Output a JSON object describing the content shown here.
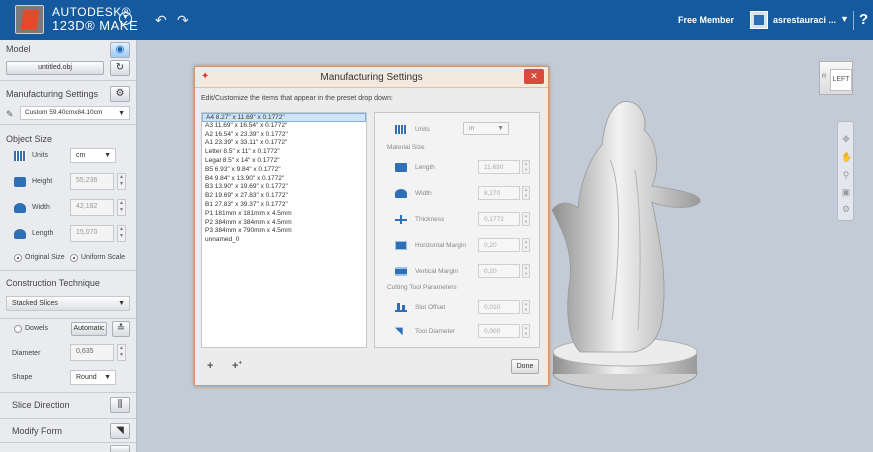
{
  "app": {
    "brand_line1": "AUTODESK®",
    "brand_line2": "123D® MAKE",
    "membership": "Free Member",
    "username": "asrestauraci ...",
    "help": "?"
  },
  "left_panel": {
    "model": {
      "title": "Model",
      "file": "untitled.obj"
    },
    "manufacturing": {
      "title": "Manufacturing Settings",
      "preset": "Custom 59.40cmx84.10cm"
    },
    "object_size": {
      "title": "Object Size",
      "units_label": "Units",
      "units_value": "cm",
      "height_label": "Height",
      "height_value": "55,236",
      "width_label": "Width",
      "width_value": "42,182",
      "length_label": "Length",
      "length_value": "15,070",
      "original_size": "Original Size",
      "uniform_scale": "Uniform Scale"
    },
    "construction": {
      "title": "Construction Technique",
      "value": "Stacked Slices"
    },
    "dowels": {
      "label": "Dowels",
      "mode": "Automatic",
      "diameter_label": "Diameter",
      "diameter_value": "0,635",
      "shape_label": "Shape",
      "shape_value": "Round"
    },
    "slice_direction": "Slice Direction",
    "modify_form": "Modify Form"
  },
  "dialog": {
    "title": "Manufacturing Settings",
    "description": "Edit/Customize the items that appear in the preset drop down:",
    "presets": [
      "A4 8.27\" x 11.69\" x 0.1772\"",
      "A3 11.69\" x 16.54\" x 0.1772\"",
      "A2 16.54\" x 23.39\" x 0.1772\"",
      "A1 23.39\" x 33.11\" x 0.1772\"",
      "Letter 8.5\" x 11\" x 0.1772\"",
      "Legal 8.5\" x 14\" x 0.1772\"",
      "B5 6.93\" x 9.84\" x 0.1772\"",
      "B4 9.84\" x 13.90\" x 0.1772\"",
      "B3 13.90\" x 19.69\" x 0.1772\"",
      "B2 19.69\" x 27.83\" x 0.1772\"",
      "B1 27.83\" x 39.37\" x 0.1772\"",
      "P1 181mm x 181mm x 4.5mm",
      "P2 384mm x 384mm x 4.5mm",
      "P3 384mm x 790mm x 4.5mm",
      "unnamed_0"
    ],
    "units_label": "Units",
    "units_value": "in",
    "material_size_header": "Material Size",
    "length_label": "Length",
    "length_value": "11,690",
    "width_label": "Width",
    "width_value": "8,270",
    "thickness_label": "Thickness",
    "thickness_value": "0,1772",
    "hmargin_label": "Horizontal Margin",
    "hmargin_value": "0,20",
    "vmargin_label": "Vertical Margin",
    "vmargin_value": "0,20",
    "cutting_header": "Cutting Tool Parameters",
    "slot_label": "Slot Offset",
    "slot_value": "0,010",
    "tool_label": "Tool Diameter",
    "tool_value": "0,000",
    "done": "Done"
  },
  "viewcube": {
    "face": "LEFT",
    "side": "R"
  },
  "colors": {
    "topbar": "#15599f",
    "accent": "#1565b5",
    "close": "#d84a3a",
    "background": "#c3cbd6"
  }
}
